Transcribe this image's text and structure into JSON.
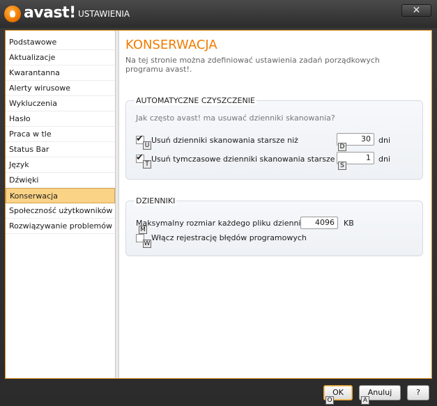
{
  "app": {
    "logo_text": "avast!",
    "title": "USTAWIENIA",
    "close_label": "✕"
  },
  "sidebar": {
    "items": [
      {
        "label": "Podstawowe"
      },
      {
        "label": "Aktualizacje"
      },
      {
        "label": "Kwarantanna"
      },
      {
        "label": "Alerty wirusowe"
      },
      {
        "label": "Wykluczenia"
      },
      {
        "label": "Hasło"
      },
      {
        "label": "Praca w tle"
      },
      {
        "label": "Status Bar"
      },
      {
        "label": "Język"
      },
      {
        "label": "Dźwięki"
      },
      {
        "label": "Konserwacja",
        "active": true
      },
      {
        "label": "Społeczność użytkowników"
      },
      {
        "label": "Rozwiązywanie problemów"
      }
    ]
  },
  "main": {
    "title": "KONSERWACJA",
    "description": "Na tej stronie można zdefiniować ustawienia zadań porządkowych programu avast!."
  },
  "auto_clean": {
    "title": "AUTOMATYCZNE CZYSZCZENIE",
    "hint": "Jak często avast! ma usuwać dzienniki skanowania?",
    "scan_logs": {
      "label": "Usuń dzienniki skanowania starsze niż",
      "checked": true,
      "accel": "U",
      "value": "30",
      "value_accel": "D",
      "unit": "dni"
    },
    "temp_logs": {
      "label": "Usuń tymczasowe dzienniki skanowania starsze niż",
      "checked": true,
      "accel": "T",
      "value": "1",
      "value_accel": "S",
      "unit": "dni"
    }
  },
  "logs": {
    "title": "DZIENNIKI",
    "max_size": {
      "label": "Maksymalny rozmiar każdego pliku dziennika:",
      "accel": "M",
      "value": "4096",
      "unit": "KB"
    },
    "error_log": {
      "label": "Włącz rejestrację błędów programowych",
      "checked": false,
      "accel": "W"
    }
  },
  "footer": {
    "ok": {
      "label": "OK",
      "accel": "O"
    },
    "cancel": {
      "label": "Anuluj",
      "accel": "A"
    },
    "help": {
      "label": "?"
    }
  }
}
